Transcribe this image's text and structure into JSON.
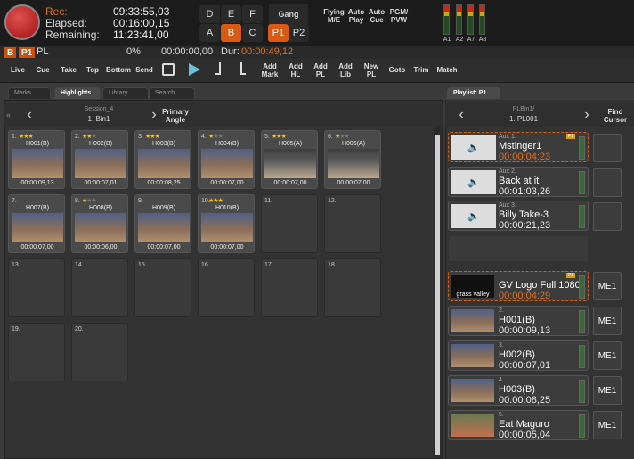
{
  "recorder": {
    "rec_label": "Rec:",
    "elapsed_label": "Elapsed:",
    "remaining_label": "Remaining:",
    "rec_time": "09:33:55,03",
    "elapsed_time": "00:16:00,15",
    "remaining_time": "11:23:41,00"
  },
  "keypad": {
    "row1": [
      "D",
      "E",
      "F"
    ],
    "row2": [
      "A",
      "B",
      "C"
    ],
    "active": "B",
    "gang": "Gang",
    "p1": "P1",
    "p2": "P2",
    "p_active": "P1"
  },
  "modes": [
    {
      "l1": "Flying",
      "l2": "M/E"
    },
    {
      "l1": "Auto",
      "l2": "Play"
    },
    {
      "l1": "Auto",
      "l2": "Cue"
    },
    {
      "l1": "PGM/",
      "l2": "PVW"
    }
  ],
  "meters": [
    "A1",
    "A2",
    "A7",
    "A8"
  ],
  "status": {
    "tag_b": "B",
    "tag_p1": "P1",
    "mode": "PL",
    "percent": "0%",
    "timecode": "00:00:00,00",
    "dur_label": "Dur:",
    "dur_value": "00:00:49,12"
  },
  "toolbar": [
    "Live",
    "Cue",
    "Take",
    "Top",
    "Bottom",
    "Send"
  ],
  "toolbar2": [
    {
      "l1": "Add",
      "l2": "Mark"
    },
    {
      "l1": "Add",
      "l2": "HL"
    },
    {
      "l1": "Add",
      "l2": "PL"
    },
    {
      "l1": "Add",
      "l2": "Lib"
    },
    {
      "l1": "New",
      "l2": "PL"
    }
  ],
  "toolbar3": [
    "Goto",
    "Trim",
    "Match"
  ],
  "tabs": [
    "Marks",
    "Highlights",
    "Library",
    "Search"
  ],
  "tab_active": "Highlights",
  "nav": {
    "session": "Session_4",
    "bin": "1. Bin1",
    "primary": "Primary",
    "angle": "Angle"
  },
  "clips": [
    {
      "n": "1.",
      "stars": 3,
      "name": "H001(B)",
      "tc": "00:00:09,13"
    },
    {
      "n": "2.",
      "stars": 2,
      "name": "H002(B)",
      "tc": "00:00:07,01"
    },
    {
      "n": "3.",
      "stars": 3,
      "name": "H003(B)",
      "tc": "00:00:08,25"
    },
    {
      "n": "4.",
      "stars": 1,
      "name": "H004(B)",
      "tc": "00:00:07,00"
    },
    {
      "n": "5.",
      "stars": 3,
      "name": "H005(A)",
      "tc": "00:00:07,00"
    },
    {
      "n": "6.",
      "stars": 1,
      "name": "H006(A)",
      "tc": "00:00:07,00"
    },
    {
      "n": "7.",
      "stars": 0,
      "name": "H007(B)",
      "tc": "00:00:07,00"
    },
    {
      "n": "8.",
      "stars": 1,
      "name": "H008(B)",
      "tc": "00:00:06,00"
    },
    {
      "n": "9.",
      "stars": 0,
      "name": "H009(B)",
      "tc": "00:00:07,00"
    },
    {
      "n": "10.",
      "stars": 3,
      "name": "H010(B)",
      "tc": "00:00:07,00"
    }
  ],
  "empty_cells": [
    "11.",
    "12.",
    "13.",
    "14.",
    "15.",
    "16.",
    "17.",
    "18.",
    "19.",
    "20."
  ],
  "playlist": {
    "tab": "Playlist: P1",
    "path": "PLBin1/",
    "name": "1. PL001",
    "find": "Find",
    "cursor": "Cursor"
  },
  "aux": [
    {
      "sub": "Aux 1.",
      "name": "Mstinger1",
      "tc": "00:00:04:23",
      "sel": true
    },
    {
      "sub": "Aux 2.",
      "name": "Back at it",
      "tc": "00:01:03,26",
      "sel": false
    },
    {
      "sub": "Aux 3.",
      "name": "Billy Take-3",
      "tc": "00:00:21,23",
      "sel": false
    }
  ],
  "events": [
    {
      "sub": "",
      "name": "GV Logo Full 1080",
      "tc": "00:00:04:29",
      "me": "ME1",
      "sel": true,
      "logo": "grass valley"
    },
    {
      "sub": "2.",
      "name": "H001(B)",
      "tc": "00:00:09,13",
      "me": "ME1"
    },
    {
      "sub": "3.",
      "name": "H002(B)",
      "tc": "00:00:07,01",
      "me": "ME1"
    },
    {
      "sub": "4.",
      "name": "H003(B)",
      "tc": "00:00:08,25",
      "me": "ME1"
    },
    {
      "sub": "5.",
      "name": "Eat Maguro",
      "tc": "00:00:05,04",
      "me": "ME1"
    }
  ],
  "p1_badge": "P1",
  "icons": {
    "speaker": "speaker-icon",
    "gv": "gv-logo"
  }
}
